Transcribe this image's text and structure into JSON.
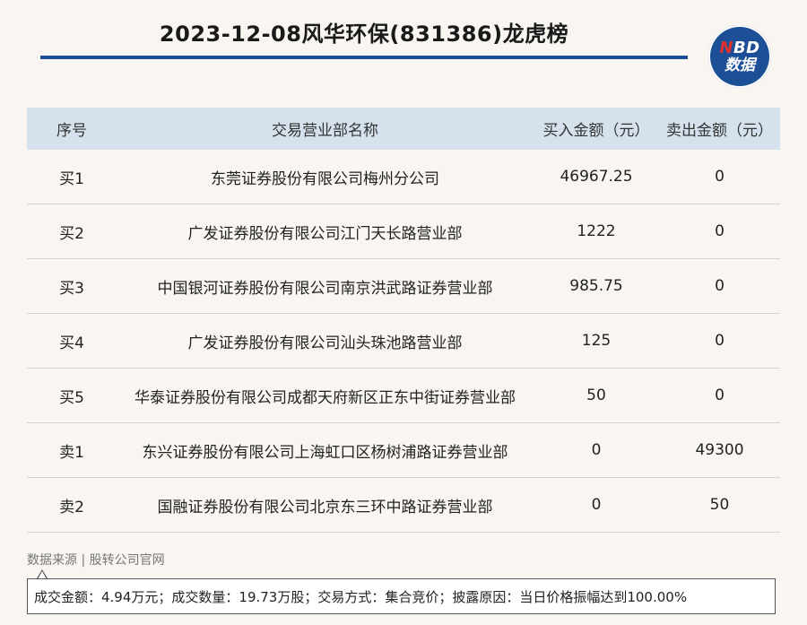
{
  "header": {
    "title": "2023-12-08风华环保(831386)龙虎榜",
    "logo_top": "NBD",
    "logo_top_first": "N",
    "logo_top_rest": "BD",
    "logo_bottom": "数据"
  },
  "table": {
    "columns": [
      "序号",
      "交易营业部名称",
      "买入金额（元）",
      "卖出金额（元）"
    ],
    "rows": [
      {
        "seq": "买1",
        "name": "东莞证券股份有限公司梅州分公司",
        "buy": "46967.25",
        "sell": "0"
      },
      {
        "seq": "买2",
        "name": "广发证券股份有限公司江门天长路营业部",
        "buy": "1222",
        "sell": "0"
      },
      {
        "seq": "买3",
        "name": "中国银河证券股份有限公司南京洪武路证券营业部",
        "buy": "985.75",
        "sell": "0"
      },
      {
        "seq": "买4",
        "name": "广发证券股份有限公司汕头珠池路营业部",
        "buy": "125",
        "sell": "0"
      },
      {
        "seq": "买5",
        "name": "华泰证券股份有限公司成都天府新区正东中街证券营业部",
        "buy": "50",
        "sell": "0"
      },
      {
        "seq": "卖1",
        "name": "东兴证券股份有限公司上海虹口区杨树浦路证券营业部",
        "buy": "0",
        "sell": "49300"
      },
      {
        "seq": "卖2",
        "name": "国融证券股份有限公司北京东三环中路证券营业部",
        "buy": "0",
        "sell": "50"
      }
    ]
  },
  "footer": {
    "source": "数据来源 | 股转公司官网",
    "note": "成交金额：4.94万元；成交数量：19.73万股；交易方式：集合竞价；披露原因：当日价格振幅达到100.00%"
  },
  "colors": {
    "accent": "#1c4f95",
    "header_bg": "#d5e2ee",
    "page_bg": "#f9f6f1",
    "logo_n": "#e0322f"
  }
}
